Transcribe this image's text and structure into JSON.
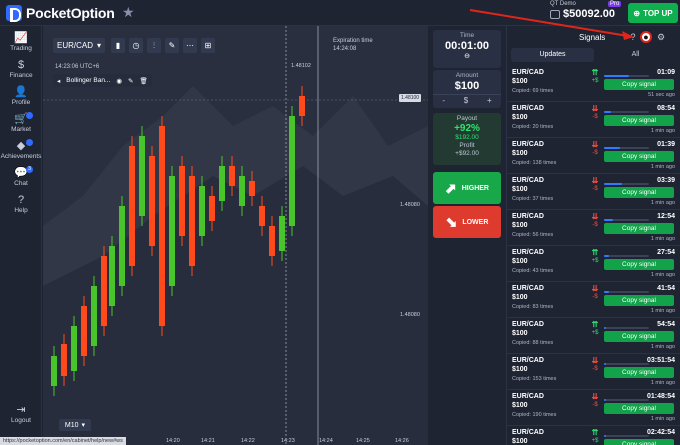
{
  "header": {
    "brand": "PocketOption",
    "account_type": "QT Demo",
    "balance": "$50092.00",
    "pro_badge": "Pro",
    "topup_label": "TOP UP"
  },
  "sidebar": {
    "items": [
      {
        "label": "Trading",
        "icon": "chart-icon"
      },
      {
        "label": "Finance",
        "icon": "dollar-icon"
      },
      {
        "label": "Profile",
        "icon": "user-icon"
      },
      {
        "label": "Market",
        "icon": "cart-icon",
        "badge": ""
      },
      {
        "label": "Achievements",
        "icon": "diamond-icon",
        "badge": ""
      },
      {
        "label": "Chat",
        "icon": "chat-icon",
        "badge": "3"
      },
      {
        "label": "Help",
        "icon": "help-icon"
      }
    ],
    "logout": "Logout"
  },
  "chart": {
    "pair": "EUR/CAD",
    "tools_badge1": "1/1",
    "tools_badge2": "1",
    "timestamp": "14:23:06 UTC+6",
    "indicator": "Bollinger Ban...",
    "expiration_label": "Expiration time",
    "expiration_value": "14:24:08",
    "price_top": "1.48102",
    "current_price": "1.48100",
    "price_mid": "1.48080",
    "price_low": "1.48080",
    "timeframe": "M10",
    "x_axis": [
      "14:19",
      "14:20",
      "14:21",
      "14:22",
      "14:23",
      "14:24",
      "14:25",
      "14:26"
    ],
    "status_url": "https://pocketoption.com/en/cabinet/help/new#ws"
  },
  "trade": {
    "time_label": "Time",
    "time_value": "00:01:00",
    "amount_label": "Amount",
    "amount_value": "$100",
    "minus": "-",
    "dollar": "$",
    "plus": "+",
    "payout_label": "Payout",
    "payout_pct": "+92%",
    "payout_amount": "$192.00",
    "profit_label": "Profit",
    "profit_value": "+$92.00",
    "higher_label": "HIGHER",
    "lower_label": "LOWER"
  },
  "signals": {
    "title": "Signals",
    "tabs": [
      "Updates",
      "All"
    ],
    "copy_label": "Copy signal",
    "items": [
      {
        "pair": "EUR/CAD",
        "amount": "$100",
        "copied": "Copied: 69 times",
        "dir": "up",
        "profit": "+$",
        "time": "01:09",
        "ago": "51 sec ago",
        "progress": 0.55
      },
      {
        "pair": "EUR/CAD",
        "amount": "$100",
        "copied": "Copied: 20 times",
        "dir": "",
        "profit": "-$",
        "time": "08:54",
        "ago": "1 min ago",
        "progress": 0.15
      },
      {
        "pair": "EUR/CAD",
        "amount": "$100",
        "copied": "Copied: 138 times",
        "dir": "",
        "profit": "-$",
        "time": "01:39",
        "ago": "1 min ago",
        "progress": 0.35
      },
      {
        "pair": "EUR/CAD",
        "amount": "$100",
        "copied": "Copied: 37 times",
        "dir": "",
        "profit": "-$",
        "time": "03:39",
        "ago": "1 min ago",
        "progress": 0.4
      },
      {
        "pair": "EUR/CAD",
        "amount": "$100",
        "copied": "Copied: 56 times",
        "dir": "",
        "profit": "-$",
        "time": "12:54",
        "ago": "1 min ago",
        "progress": 0.2
      },
      {
        "pair": "EUR/CAD",
        "amount": "$100",
        "copied": "Copied: 43 times",
        "dir": "up",
        "profit": "+$",
        "time": "27:54",
        "ago": "1 min ago",
        "progress": 0.1
      },
      {
        "pair": "EUR/CAD",
        "amount": "$100",
        "copied": "Copied: 83 times",
        "dir": "",
        "profit": "-$",
        "time": "41:54",
        "ago": "1 min ago",
        "progress": 0.1
      },
      {
        "pair": "EUR/CAD",
        "amount": "$100",
        "copied": "Copied: 88 times",
        "dir": "up",
        "profit": "+$",
        "time": "54:54",
        "ago": "1 min ago",
        "progress": 0.05
      },
      {
        "pair": "EUR/CAD",
        "amount": "$100",
        "copied": "Copied: 153 times",
        "dir": "",
        "profit": "-$",
        "time": "03:51:54",
        "ago": "1 min ago",
        "progress": 0.05
      },
      {
        "pair": "EUR/CAD",
        "amount": "$100",
        "copied": "Copied: 190 times",
        "dir": "",
        "profit": "-$",
        "time": "01:48:54",
        "ago": "1 min ago",
        "progress": 0.05
      },
      {
        "pair": "EUR/CAD",
        "amount": "$100",
        "copied": "",
        "dir": "up",
        "profit": "+$",
        "time": "02:42:54",
        "ago": "",
        "progress": 0.05
      }
    ]
  }
}
